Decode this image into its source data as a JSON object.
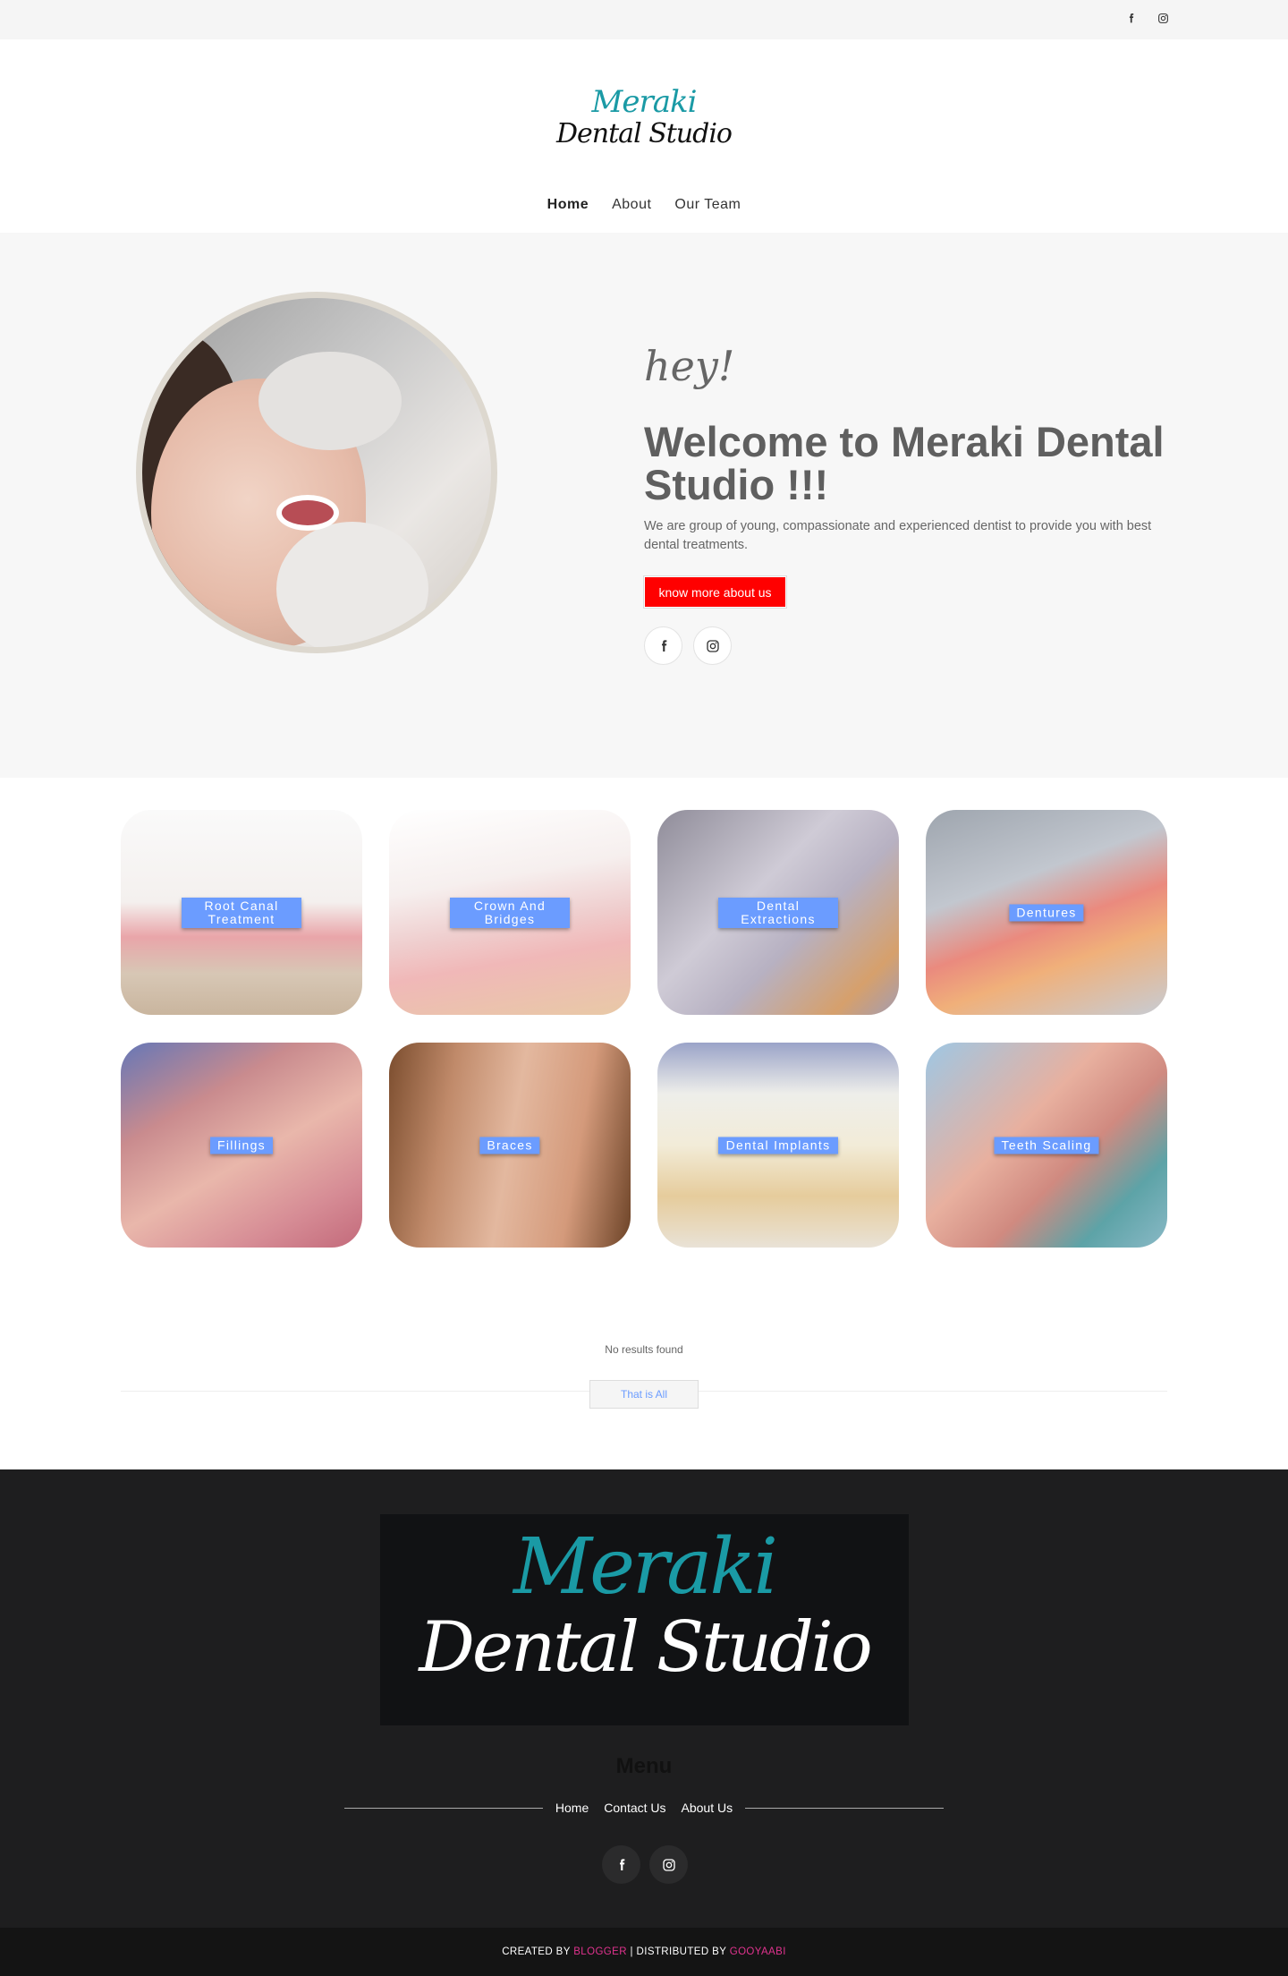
{
  "topbar": {
    "icons": [
      "facebook-icon",
      "instagram-icon"
    ]
  },
  "logo": {
    "line1": "Meraki",
    "line2": "Dental Studio"
  },
  "nav": {
    "items": [
      {
        "label": "Home"
      },
      {
        "label": "About"
      },
      {
        "label": "Our Team"
      }
    ]
  },
  "hero": {
    "greeting": "hey!",
    "title": "Welcome to Meraki Dental Studio !!!",
    "lead": "We are group of young, compassionate and experienced dentist to provide you with best dental treatments.",
    "cta_label": "know more about us"
  },
  "services": [
    {
      "label": "Root Canal Treatment"
    },
    {
      "label": "Crown And Bridges"
    },
    {
      "label": "Dental Extractions"
    },
    {
      "label": "Dentures"
    },
    {
      "label": "Fillings"
    },
    {
      "label": "Braces"
    },
    {
      "label": "Dental Implants"
    },
    {
      "label": "Teeth Scaling"
    }
  ],
  "results": {
    "empty_text": "No results found",
    "end_label": "That is All"
  },
  "footer": {
    "logo_line1": "Meraki",
    "logo_line2": "Dental Studio",
    "menu_title": "Menu",
    "links": [
      {
        "label": "Home"
      },
      {
        "label": "Contact Us"
      },
      {
        "label": "About Us"
      }
    ]
  },
  "bottombar": {
    "created_prefix": "CREATED BY",
    "created_by": "BLOGGER",
    "distributed_prefix": "| DISTRIBUTED BY",
    "distributed_by": "GOOYAABI"
  },
  "colors": {
    "accent_teal": "#1a9aa5",
    "cta_red": "#ff0000",
    "label_blue": "#6b9cff",
    "credit_pink": "#e0338e",
    "footer_bg": "#1e1e1f"
  }
}
